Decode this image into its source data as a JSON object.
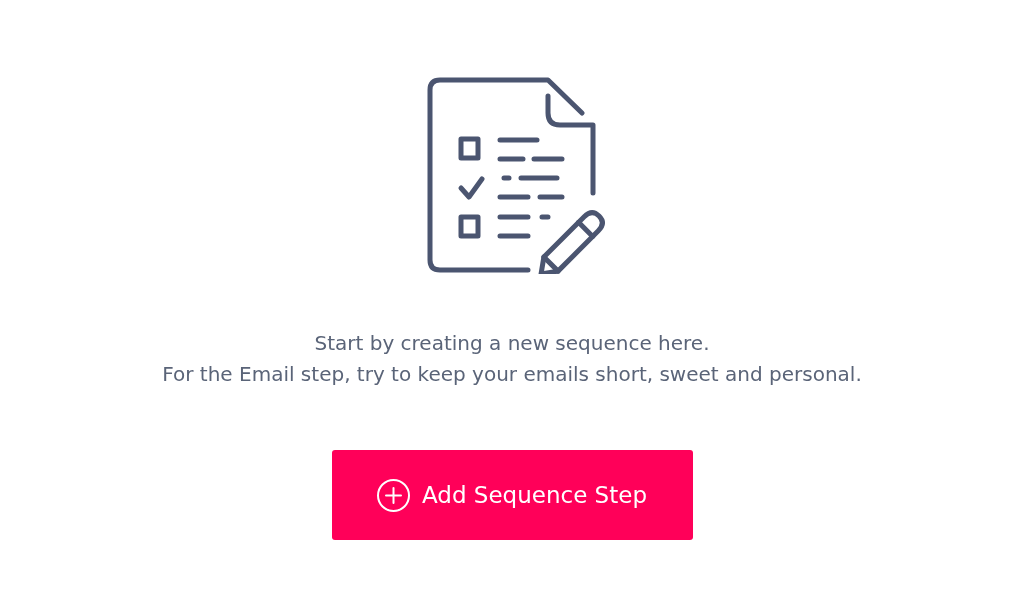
{
  "empty_state": {
    "message_lines": [
      "Start by creating a new sequence here.",
      "For the Email step, try to keep your emails short, sweet and personal."
    ],
    "button": {
      "label": "Add Sequence Step"
    }
  }
}
